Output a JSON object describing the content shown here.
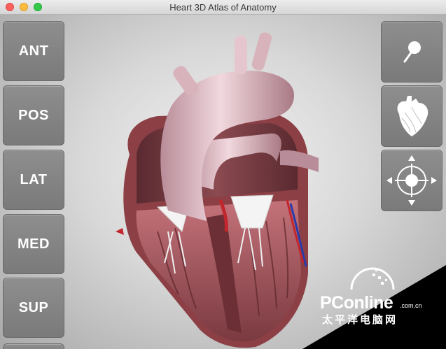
{
  "window": {
    "title": "Heart 3D Atlas of Anatomy"
  },
  "view_buttons": [
    {
      "label": "ANT"
    },
    {
      "label": "POS"
    },
    {
      "label": "LAT"
    },
    {
      "label": "MED"
    },
    {
      "label": "SUP"
    }
  ],
  "tools": [
    {
      "icon": "pin-icon"
    },
    {
      "icon": "heart-model-icon"
    },
    {
      "icon": "move-crosshair-icon"
    }
  ],
  "watermark": {
    "brand": "PConline",
    "domain": ".com.cn",
    "chinese": "太平洋电脑网"
  }
}
